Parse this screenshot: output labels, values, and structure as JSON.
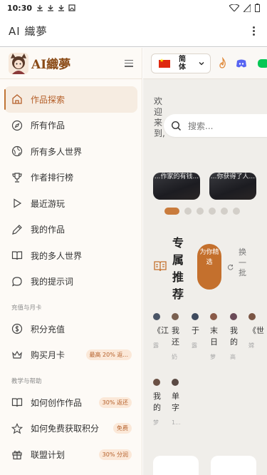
{
  "statusbar": {
    "time": "10:30"
  },
  "appbar": {
    "title": "AI 織夢"
  },
  "sidebar": {
    "logo_text": "AI織夢",
    "items": [
      {
        "label": "作品探索",
        "icon": "home-icon",
        "active": true
      },
      {
        "label": "所有作品",
        "icon": "compass-icon"
      },
      {
        "label": "所有多人世界",
        "icon": "globe-icon"
      },
      {
        "label": "作者排行榜",
        "icon": "trophy-icon"
      },
      {
        "label": "最近游玩",
        "icon": "play-icon"
      },
      {
        "label": "我的作品",
        "icon": "pencil-icon"
      },
      {
        "label": "我的多人世界",
        "icon": "book-icon"
      },
      {
        "label": "我的提示词",
        "icon": "chat-icon"
      }
    ],
    "section_recharge": "充值与月卡",
    "recharge_items": [
      {
        "label": "积分充值",
        "icon": "coin-icon"
      },
      {
        "label": "购买月卡",
        "icon": "crown-icon",
        "badge": "最高 20% 返..."
      }
    ],
    "section_help": "教学与帮助",
    "help_items": [
      {
        "label": "如何创作作品",
        "icon": "book-open-icon",
        "badge": "30% 返还"
      },
      {
        "label": "如何免费获取积分",
        "icon": "star-icon",
        "badge": "免费"
      },
      {
        "label": "联盟计划",
        "icon": "gift-icon",
        "badge": "30% 分润"
      }
    ]
  },
  "main": {
    "language": "简体",
    "welcome": "欢迎来到,",
    "search_placeholder": "搜索...",
    "banners": [
      "...作家的有钱...",
      "...你获得了人..."
    ],
    "recommend_title": "专属推荐",
    "recommend_pill": "为你精选",
    "swap_label": "换一批",
    "works": [
      {
        "title": "《江",
        "sub": "露"
      },
      {
        "title": "我还",
        "sub": "奶"
      },
      {
        "title": "于",
        "sub": "露"
      },
      {
        "title": "末日",
        "sub": "萝"
      },
      {
        "title": "我的",
        "sub": "高"
      },
      {
        "title": "《世",
        "sub": "嫦"
      },
      {
        "title": "我的",
        "sub": "梦"
      },
      {
        "title": "单字",
        "sub": "1..."
      }
    ]
  },
  "colors": {
    "accent": "#c4702d",
    "active_bg": "#f6ece1"
  }
}
